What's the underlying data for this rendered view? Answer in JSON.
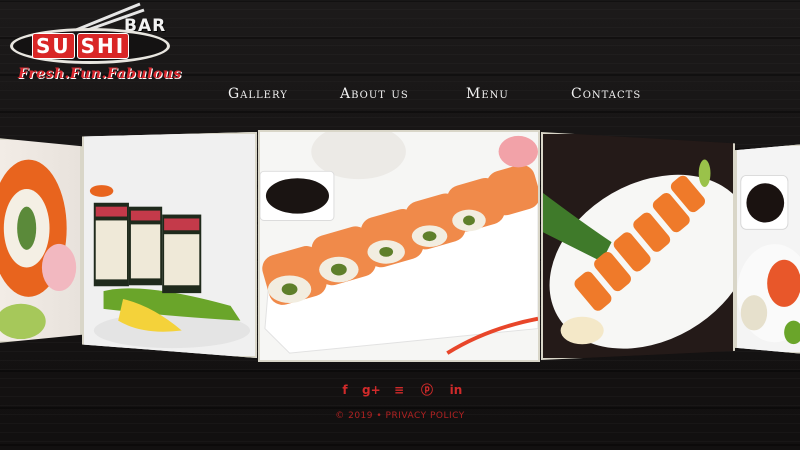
{
  "logo": {
    "bar_text": "BAR",
    "name_letters": [
      "SU",
      "SHI"
    ],
    "tagline": "Fresh.Fun.Fabulous"
  },
  "nav": {
    "items": [
      {
        "label": "Gallery"
      },
      {
        "label": "About us"
      },
      {
        "label": "Menu"
      },
      {
        "label": "Contacts"
      }
    ]
  },
  "social": {
    "icons": [
      {
        "name": "facebook-icon",
        "glyph": "f"
      },
      {
        "name": "google-plus-icon",
        "glyph": "g+"
      },
      {
        "name": "rss-icon",
        "glyph": "≡"
      },
      {
        "name": "pinterest-icon",
        "glyph": "ⓟ"
      },
      {
        "name": "linkedin-icon",
        "glyph": "in"
      }
    ]
  },
  "footer": {
    "copyright": "© 2019 •",
    "privacy_label": "PRIVACY POLICY"
  },
  "colors": {
    "accent": "#d02a2a",
    "nav_text": "#f2f2f2",
    "background": "#161414",
    "frame": "#d9d6c8"
  }
}
